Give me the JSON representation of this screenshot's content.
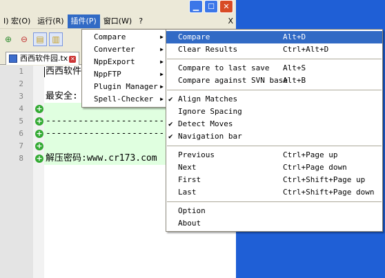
{
  "menubar": {
    "items": [
      "I) 宏(O)",
      "运行(R)",
      "插件(P)",
      "窗口(W)",
      "?"
    ],
    "close": "X"
  },
  "tab": {
    "label": "西西软件园.tx"
  },
  "editor": {
    "lines": [
      {
        "num": "1",
        "text": "西西软件"
      },
      {
        "num": "2",
        "text": ""
      },
      {
        "num": "3",
        "text": "最安全:"
      },
      {
        "num": "4",
        "text": ""
      },
      {
        "num": "5",
        "text": "------------------------"
      },
      {
        "num": "6",
        "text": "------------------------"
      },
      {
        "num": "7",
        "text": ""
      },
      {
        "num": "8",
        "text": "解压密码:www.cr173.com"
      }
    ]
  },
  "plugin_menu": {
    "items": [
      "Compare",
      "Converter",
      "NppExport",
      "NppFTP",
      "Plugin Manager",
      "Spell-Checker"
    ]
  },
  "compare_menu": {
    "compare": {
      "label": "Compare",
      "shortcut": "Alt+D"
    },
    "clear": {
      "label": "Clear Results",
      "shortcut": "Ctrl+Alt+D"
    },
    "last_save": {
      "label": "Compare to last save",
      "shortcut": "Alt+S"
    },
    "svn": {
      "label": "Compare against SVN base",
      "shortcut": "Alt+B"
    },
    "align": {
      "label": "Align Matches",
      "checked": "✔"
    },
    "ignore_spacing": {
      "label": "Ignore Spacing"
    },
    "detect_moves": {
      "label": "Detect Moves",
      "checked": "✔"
    },
    "nav_bar": {
      "label": "Navigation bar",
      "checked": "✔"
    },
    "previous": {
      "label": "Previous",
      "shortcut": "Ctrl+Page up"
    },
    "next": {
      "label": "Next",
      "shortcut": "Ctrl+Page down"
    },
    "first": {
      "label": "First",
      "shortcut": "Ctrl+Shift+Page up"
    },
    "last": {
      "label": "Last",
      "shortcut": "Ctrl+Shift+Page down"
    },
    "option": {
      "label": "Option"
    },
    "about": {
      "label": "About"
    }
  },
  "colors": {
    "highlight": "#316AC5",
    "added_line": "#E0FFE0",
    "desktop": "#1F5FD6"
  }
}
